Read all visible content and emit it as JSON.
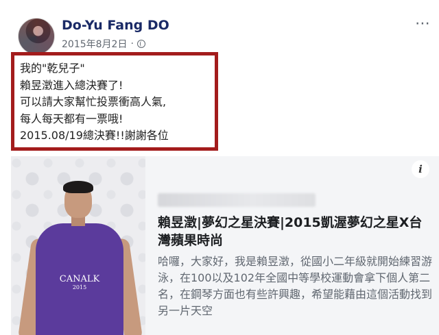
{
  "post": {
    "author": "Do-Yu Fang DO",
    "date": "2015年8月2日",
    "date_separator": "·",
    "more_icon": "⋯",
    "text_lines": [
      "我的\"乾兒子\"",
      "賴昱澂進入總決賽了!",
      " 可以請大家幫忙投票衝高人氣,",
      "每人每天都有一票哦!",
      "2015.08/19總決賽!!謝謝各位"
    ]
  },
  "link_card": {
    "info_icon": "i",
    "image_shirt_text": "CANALK",
    "image_shirt_year": "2015",
    "title": "賴昱澂|夢幻之星決賽|2015凱渥夢幻之星X台灣蘋果時尚",
    "description": "哈囉，大家好，我是賴昱澂，從國小二年級就開始練習游泳，在100以及102年全國中等學校運動會拿下個人第二名，在鋼琴方面也有些許興趣，希望能藉由這個活動找到另一片天空"
  },
  "colors": {
    "author": "#1a2a66",
    "highlight_border": "#a31c1c",
    "meta": "#606770",
    "card_background": "#f4f5f7"
  }
}
